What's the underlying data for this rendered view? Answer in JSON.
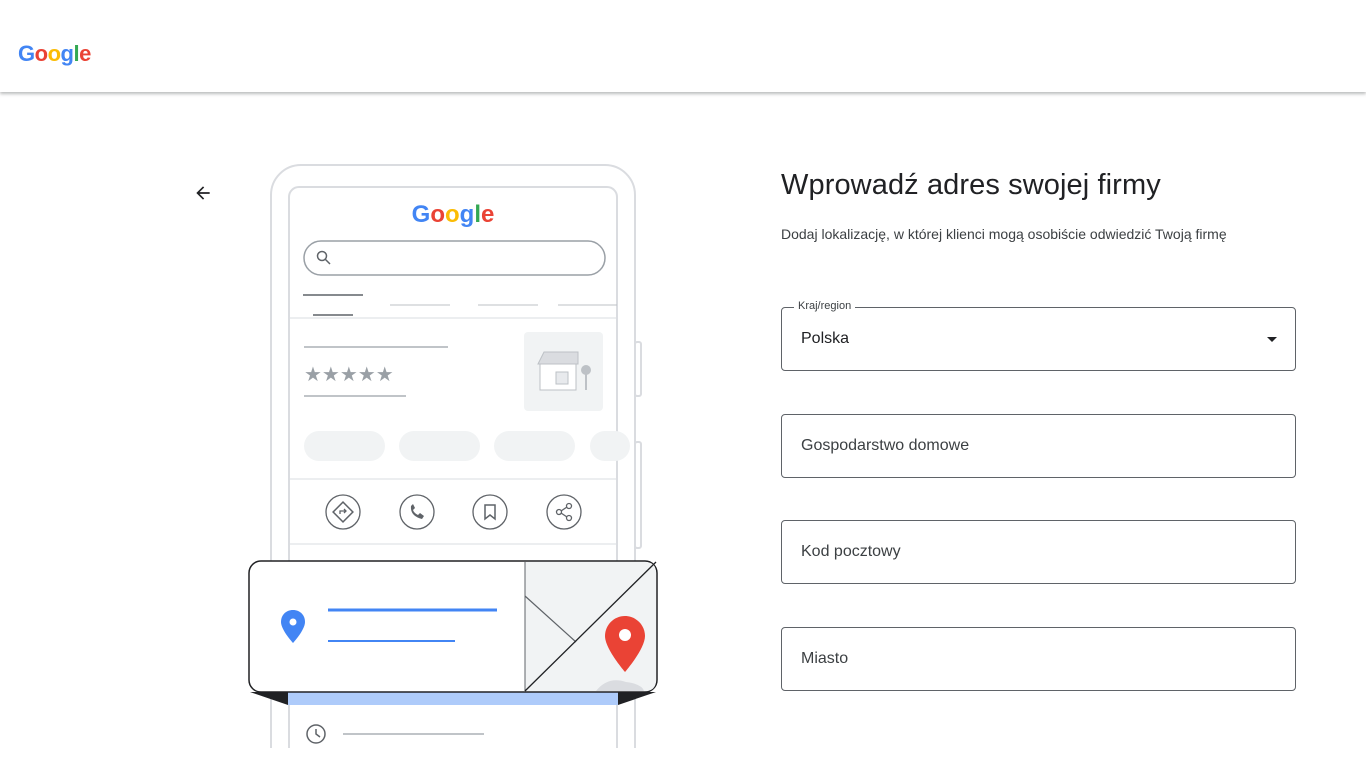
{
  "header": {
    "logo_letters": [
      {
        "ch": "G",
        "color": "#4285F4"
      },
      {
        "ch": "o",
        "color": "#EA4335"
      },
      {
        "ch": "o",
        "color": "#FBBC05"
      },
      {
        "ch": "g",
        "color": "#4285F4"
      },
      {
        "ch": "l",
        "color": "#34A853"
      },
      {
        "ch": "e",
        "color": "#EA4335"
      }
    ]
  },
  "navigation": {
    "back_icon": "arrow-left-icon"
  },
  "illustration": {
    "phone_logo": "Google",
    "stars": "★★★★★",
    "icons": [
      "directions-icon",
      "phone-icon",
      "bookmark-icon",
      "share-icon",
      "location-pin-icon",
      "clock-icon",
      "store-icon",
      "search-icon"
    ]
  },
  "form": {
    "title": "Wprowadź adres swojej firmy",
    "subtitle": "Dodaj lokalizację, w której klienci mogą osobiście odwiedzić Twoją firmę",
    "country": {
      "label": "Kraj/region",
      "value": "Polska"
    },
    "street": {
      "placeholder": "Gospodarstwo domowe"
    },
    "postal_code": {
      "placeholder": "Kod pocztowy"
    },
    "city": {
      "placeholder": "Miasto"
    }
  },
  "colors": {
    "blue": "#4285F4",
    "red": "#EA4335",
    "yellow": "#FBBC05",
    "green": "#34A853",
    "pin_red": "#EA4335",
    "bar_blue": "#AECBFA"
  }
}
